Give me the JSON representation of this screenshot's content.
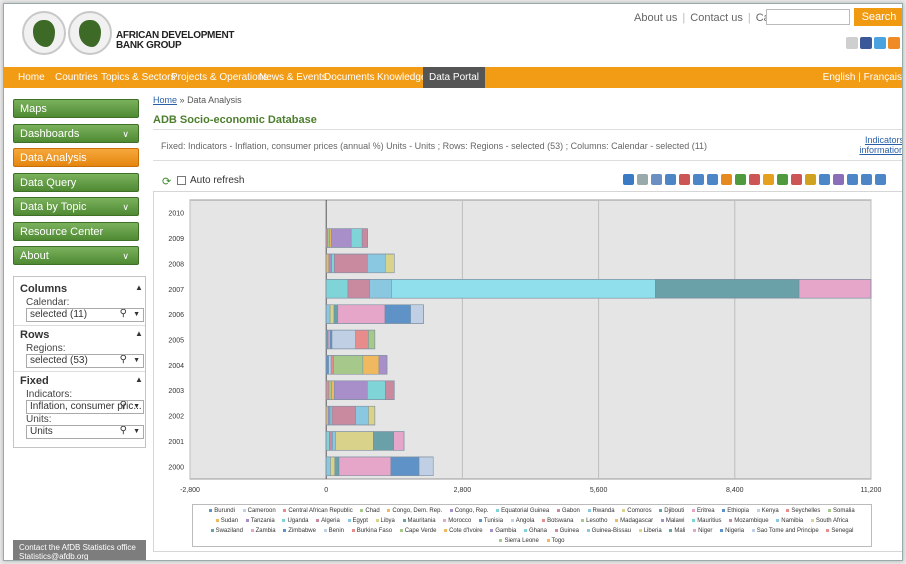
{
  "header": {
    "brand_line1": "AFRICAN DEVELOPMENT",
    "brand_line2": "BANK GROUP",
    "top_links": [
      "About us",
      "Contact us",
      "Careers"
    ],
    "search_label": "Search"
  },
  "nav": {
    "items": [
      "Home",
      "Countries",
      "Topics & Sectors",
      "Projects & Operations",
      "News & Events",
      "Documents",
      "Knowledge",
      "Data Portal"
    ],
    "active": "Data Portal",
    "lang_english": "English",
    "lang_sep": "|",
    "lang_french": "Français"
  },
  "sidebar": {
    "items": [
      {
        "label": "Maps",
        "chevron": false,
        "active": false
      },
      {
        "label": "Dashboards",
        "chevron": true,
        "active": false
      },
      {
        "label": "Data Analysis",
        "chevron": false,
        "active": true
      },
      {
        "label": "Data Query",
        "chevron": false,
        "active": false
      },
      {
        "label": "Data by Topic",
        "chevron": true,
        "active": false
      },
      {
        "label": "Resource Center",
        "chevron": false,
        "active": false
      },
      {
        "label": "About",
        "chevron": true,
        "active": false
      }
    ],
    "panel": {
      "columns_title": "Columns",
      "calendar_label": "Calendar:",
      "calendar_value": "selected (11)",
      "rows_title": "Rows",
      "regions_label": "Regions:",
      "regions_value": "selected (53)",
      "fixed_title": "Fixed",
      "indicators_label": "Indicators:",
      "indicators_value": "Inflation, consumer pric...",
      "units_label": "Units:",
      "units_value": "Units"
    },
    "contact_line": "Contact the AfDB Statistics office",
    "contact_email": "Statistics@afdb.org"
  },
  "main": {
    "breadcrumb_home": "Home",
    "breadcrumb_sep": "»",
    "breadcrumb_current": "Data Analysis",
    "title": "ADB Socio-economic Database",
    "filter_text": "Fixed: Indicators - Inflation, consumer prices (annual %) Units - Units ; Rows: Regions - selected (53) ; Columns: Calendar - selected (11)",
    "info_link_line1": "Indicators",
    "info_link_line2": "information",
    "auto_refresh_label": "Auto refresh"
  },
  "chart_data": {
    "type": "bar",
    "orientation": "horizontal",
    "stacked": true,
    "categories": [
      "2010",
      "2009",
      "2008",
      "2007",
      "2006",
      "2005",
      "2004",
      "2003",
      "2002",
      "2001",
      "2000"
    ],
    "totals": [
      0,
      850,
      1400,
      11200,
      2000,
      1000,
      1250,
      1400,
      1000,
      1600,
      2200
    ],
    "xlim": [
      -2800,
      11200
    ],
    "xticks": [
      "-2,800",
      "0",
      "2,800",
      "5,600",
      "8,400",
      "11,200"
    ],
    "legend": [
      "Burundi",
      "Cameroon",
      "Central African Republic",
      "Chad",
      "Congo, Dem. Rep.",
      "Congo, Rep.",
      "Equatorial Guinea",
      "Gabon",
      "Rwanda",
      "Comoros",
      "Djibouti",
      "Eritrea",
      "Ethiopia",
      "Kenya",
      "Seychelles",
      "Somalia",
      "Sudan",
      "Tanzania",
      "Uganda",
      "Algeria",
      "Egypt",
      "Libya",
      "Mauritania",
      "Morocco",
      "Tunisia",
      "Angola",
      "Botswana",
      "Lesotho",
      "Madagascar",
      "Malawi",
      "Mauritius",
      "Mozambique",
      "Namibia",
      "South Africa",
      "Swaziland",
      "Zambia",
      "Zimbabwe",
      "Benin",
      "Burkina Faso",
      "Cape Verde",
      "Cote d'Ivoire",
      "Gambia",
      "Ghana",
      "Guinea",
      "Guinea-Bissau",
      "Liberia",
      "Mali",
      "Niger",
      "Nigeria",
      "Sao Tome and Principe",
      "Senegal",
      "Sierra Leone",
      "Togo"
    ],
    "grid": true
  },
  "colors": {
    "nav_orange": "#f29b15",
    "side_green": "#5e9a3e",
    "side_active": "#ec8e1a",
    "title_green": "#4d7e2e",
    "plot_bg": "#e5e5e5"
  }
}
